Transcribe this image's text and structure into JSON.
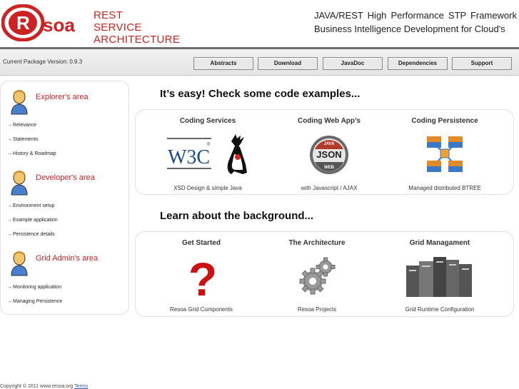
{
  "header": {
    "logo_text": "soa",
    "title_line1": "REST SERVICE",
    "title_line2": "ARCHITECTURE",
    "tagline_line1": "JAVA/REST High Performance STP Framework",
    "tagline_line2": "Business Intelligence Development for Cloud's"
  },
  "navbar": {
    "version": "Current Package Version: 0.9.3",
    "buttons": [
      "Abstracts",
      "Download",
      "JavaDoc",
      "Dependencies",
      "Support"
    ]
  },
  "sidebar": {
    "sections": [
      {
        "title": "Explorer's area",
        "links": [
          "Relevance",
          "Statements",
          "History & Roadmap"
        ]
      },
      {
        "title": "Developer's area",
        "links": [
          "Environment setup",
          "Example application",
          "Persistence details"
        ]
      },
      {
        "title": "Grid Admin's area",
        "links": [
          "Monitoring application",
          "Managing Persistence"
        ]
      }
    ],
    "arrow": "→"
  },
  "main": {
    "section1_title": "It’s easy! Check some code examples...",
    "section1_cols": [
      {
        "title": "Coding Services",
        "caption": "XSD Design & simple Java"
      },
      {
        "title": "Coding Web App’s",
        "caption": "with Javascript / AJAX"
      },
      {
        "title": "Coding Persistence",
        "caption": "Managed distributed BTREE"
      }
    ],
    "section2_title": "Learn about the background...",
    "section2_cols": [
      {
        "title": "Get Started",
        "caption": "Resoa Grid Components"
      },
      {
        "title": "The Architecture",
        "caption": "Resoa Projects"
      },
      {
        "title": "Grid Managament",
        "caption": "Grid Runtime Configuration"
      }
    ],
    "w3c_text": "W3C",
    "json_top": "JAVA",
    "json_mid": "JSON",
    "json_bottom": "WEB",
    "question_mark": "?"
  },
  "footer": {
    "text": "Copyright © 2011 www.resoa.org",
    "terms": "Terms"
  },
  "colors": {
    "brand_red": "#cc2222",
    "bar_dark": "#6e6e6e"
  }
}
